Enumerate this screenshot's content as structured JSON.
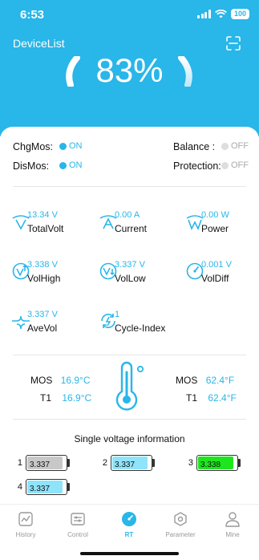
{
  "status": {
    "time": "6:53",
    "battery": "100"
  },
  "header": {
    "title": "DeviceList",
    "percent": "83%"
  },
  "switches": {
    "chgmos": {
      "label": "ChgMos:",
      "value": "ON"
    },
    "balance": {
      "label": "Balance :",
      "value": "OFF"
    },
    "dismos": {
      "label": "DisMos:",
      "value": "ON"
    },
    "protection": {
      "label": "Protection:",
      "value": "OFF"
    }
  },
  "metrics": {
    "totalvolt": {
      "value": "13.34 V",
      "label": "TotalVolt",
      "icon": "total-volt-icon"
    },
    "current": {
      "value": "0.00 A",
      "label": "Current",
      "icon": "current-icon"
    },
    "power": {
      "value": "0.00 W",
      "label": "Power",
      "icon": "power-icon"
    },
    "volhigh": {
      "value": "3.338 V",
      "label": "VolHigh",
      "icon": "vol-high-icon"
    },
    "vollow": {
      "value": "3.337 V",
      "label": "VolLow",
      "icon": "vol-low-icon"
    },
    "voldiff": {
      "value": "0.001 V",
      "label": "VolDiff",
      "icon": "vol-diff-icon"
    },
    "avevol": {
      "value": "3.337 V",
      "label": "AveVol",
      "icon": "ave-vol-icon"
    },
    "cycle": {
      "value": "1",
      "label": "Cycle-Index",
      "icon": "cycle-index-icon"
    }
  },
  "temps": {
    "left": [
      {
        "label": "MOS",
        "value": "16.9°C"
      },
      {
        "label": "T1",
        "value": "16.9°C"
      }
    ],
    "right": [
      {
        "label": "MOS",
        "value": "62.4°F"
      },
      {
        "label": "T1",
        "value": "62.4°F"
      }
    ]
  },
  "single_voltage": {
    "title": "Single voltage information",
    "cells": [
      {
        "index": "1",
        "value": "3.337",
        "color": "#c8c8c8",
        "fill": 0.92
      },
      {
        "index": "2",
        "value": "3.337",
        "color": "#8fe3fb",
        "fill": 0.92
      },
      {
        "index": "3",
        "value": "3.338",
        "color": "#1ee61e",
        "fill": 0.92
      },
      {
        "index": "4",
        "value": "3.337",
        "color": "#8fe3fb",
        "fill": 0.92
      }
    ]
  },
  "tabs": [
    {
      "label": "History",
      "icon": "history-icon",
      "active": false
    },
    {
      "label": "Control",
      "icon": "control-icon",
      "active": false
    },
    {
      "label": "RT",
      "icon": "rt-icon",
      "active": true
    },
    {
      "label": "Parameter",
      "icon": "parameter-icon",
      "active": false
    },
    {
      "label": "Mine",
      "icon": "mine-icon",
      "active": false
    }
  ],
  "colors": {
    "accent": "#29b6e8",
    "off": "#cccccc"
  }
}
